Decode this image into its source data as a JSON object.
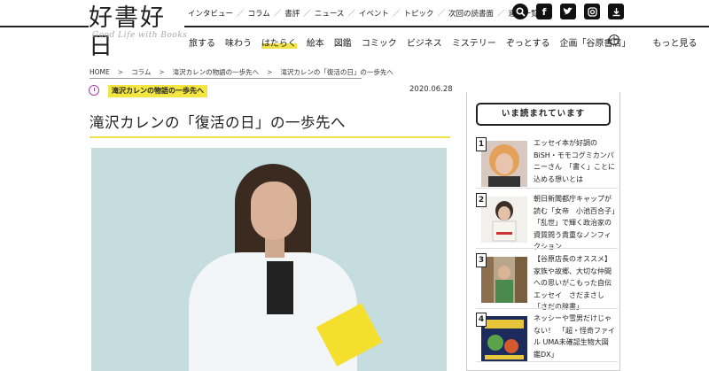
{
  "logo": {
    "main": "好書好日",
    "sub": "Good Life with Books"
  },
  "top_nav": [
    "インタビュー",
    "コラム",
    "書評",
    "ニュース",
    "イベント",
    "トピック",
    "次回の読書面",
    "連載一覧"
  ],
  "social_icons": [
    "search-icon",
    "facebook-icon",
    "twitter-icon",
    "instagram-icon",
    "bookmark-icon"
  ],
  "category_nav": {
    "items": [
      "旅する",
      "味わう",
      "はたらく",
      "絵本",
      "図鑑",
      "コミック",
      "ビジネス",
      "ミステリー",
      "ぞっとする",
      "企画「谷原書店」"
    ],
    "active": "はたらく",
    "more": "もっと見る"
  },
  "breadcrumb": [
    "HOME",
    "コラム",
    "滝沢カレンの物語の一歩先へ",
    "滝沢カレンの「復活の日」の一歩先へ"
  ],
  "article": {
    "series_tag": "滝沢カレンの物語の一歩先へ",
    "date": "2020.06.28",
    "title": "滝沢カレンの「復活の日」の一歩先へ"
  },
  "ranking": {
    "title": "いま読まれています",
    "items": [
      {
        "rank": "1",
        "text": "エッセイ本が好調のBiSH・モモコグミカンパニーさん　「書く」ことに込める想いとは"
      },
      {
        "rank": "2",
        "text": "朝日新聞都庁キャップが読む「女帝　小池百合子」　「乱世」で輝く政治家の資質問う貴重なノンフィクション"
      },
      {
        "rank": "3",
        "text": "【谷原店長のオススメ】家族や故郷、大切な仲間への思いがこもった自伝エッセイ　さだまさし「さだの辞書」"
      },
      {
        "rank": "4",
        "text": "ネッシーや雪男だけじゃない！　「超・怪奇ファイル UMA未確認生物大図鑑DX」"
      }
    ]
  },
  "colors": {
    "accent_yellow": "#f3e640",
    "clock_purple": "#aa3fa8"
  }
}
